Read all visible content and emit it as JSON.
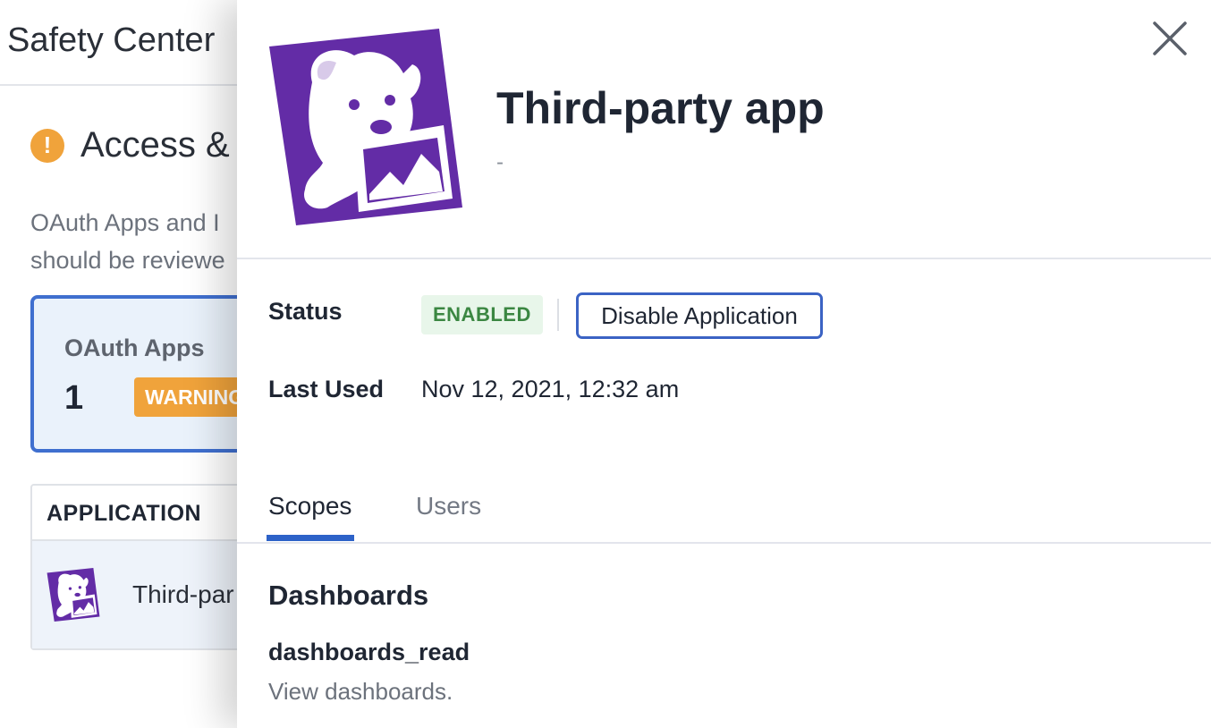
{
  "background_page": {
    "title": "Safety Center",
    "section_title": "Access & S",
    "description_lines": [
      "OAuth Apps and I",
      "should be reviewe"
    ],
    "card": {
      "title": "OAuth Apps",
      "count": "1",
      "badge": "WARNING"
    },
    "table": {
      "header": "APPLICATION",
      "rows": [
        {
          "name": "Third-par"
        }
      ]
    }
  },
  "drawer": {
    "app_title": "Third-party app",
    "app_subtitle": "-",
    "status_label": "Status",
    "status_value": "ENABLED",
    "disable_button": "Disable Application",
    "last_used_label": "Last Used",
    "last_used_value": "Nov 12, 2021, 12:32 am",
    "tabs": [
      {
        "label": "Scopes",
        "active": true
      },
      {
        "label": "Users",
        "active": false
      }
    ],
    "scopes": {
      "group_title": "Dashboards",
      "items": [
        {
          "name": "dashboards_read",
          "description": "View dashboards."
        }
      ]
    }
  },
  "colors": {
    "brand_purple": "#632ca6",
    "accent_blue": "#3b63c4",
    "warning_orange": "#f0a33b",
    "enabled_green": "#3b8742"
  },
  "icons": {
    "close": "close-icon",
    "warning": "warning-icon",
    "logo": "dog-logo-icon"
  }
}
